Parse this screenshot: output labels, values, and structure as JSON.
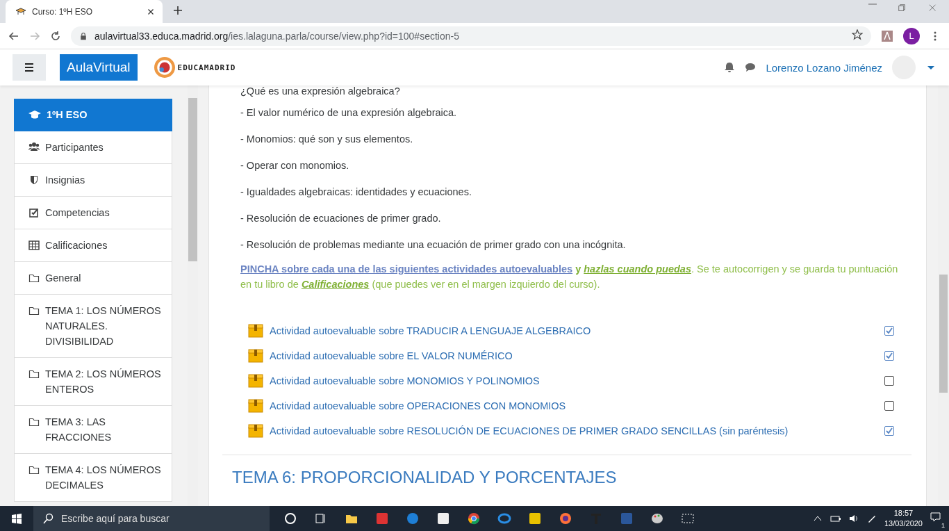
{
  "browser": {
    "tab_title": "Curso: 1ºH ESO",
    "url_host": "aulavirtual33.educa.madrid.org",
    "url_path": "/ies.lalaguna.parla/course/view.php?id=100#section-5",
    "profile_initial": "L"
  },
  "header": {
    "brand": "AulaVirtual",
    "logo_text": "EDUCAMADRID",
    "user_name": "Lorenzo Lozano Jiménez"
  },
  "sidebar": {
    "items": [
      {
        "label": "1ºH ESO",
        "kind": "course",
        "selected": true
      },
      {
        "label": "Participantes",
        "kind": "users",
        "selected": false
      },
      {
        "label": "Insignias",
        "kind": "badge",
        "selected": false
      },
      {
        "label": "Competencias",
        "kind": "check",
        "selected": false
      },
      {
        "label": "Calificaciones",
        "kind": "table",
        "selected": false
      },
      {
        "label": "General",
        "kind": "folder",
        "selected": false
      },
      {
        "label": "TEMA 1: LOS NÚMEROS NATURALES. DIVISIBILIDAD",
        "kind": "folder",
        "selected": false
      },
      {
        "label": "TEMA 2: LOS NÚMEROS ENTEROS",
        "kind": "folder",
        "selected": false
      },
      {
        "label": "TEMA 3: LAS FRACCIONES",
        "kind": "folder",
        "selected": false
      },
      {
        "label": "TEMA 4: LOS NÚMEROS DECIMALES",
        "kind": "folder",
        "selected": false
      }
    ]
  },
  "content": {
    "lines": [
      "¿Qué es una expresión algebraica?",
      "- El valor numérico de una expresión algebraica.",
      "- Monomios: qué son y sus elementos.",
      "- Operar con monomios.",
      "- Igualdades algebraicas: identidades y ecuaciones.",
      "- Resolución de ecuaciones de primer grado.",
      "- Resolución de problemas mediante una ecuación de primer grado con una incógnita."
    ],
    "instruction": [
      {
        "text": "PINCHA sobre cada una de las siguientes actividades autoevaluables",
        "kind": "link"
      },
      {
        "text": " y ",
        "kind": "bold"
      },
      {
        "text": "hazlas cuando puedas",
        "kind": "bold-italic"
      },
      {
        "text": ". Se te autocorrigen y se guarda tu puntuación en tu libro de ",
        "kind": "plain"
      },
      {
        "text": "Calificaciones",
        "kind": "bold-italic"
      },
      {
        "text": " (que puedes ver en el margen izquierdo del curso).",
        "kind": "plain"
      }
    ],
    "activities": [
      {
        "title": "Actividad autoevaluable sobre TRADUCIR A LENGUAJE ALGEBRAICO",
        "checked": true
      },
      {
        "title": "Actividad autoevaluable sobre EL VALOR NUMÉRICO",
        "checked": true
      },
      {
        "title": "Actividad autoevaluable sobre MONOMIOS Y POLINOMIOS",
        "checked": false
      },
      {
        "title": "Actividad autoevaluable sobre OPERACIONES CON MONOMIOS",
        "checked": false
      },
      {
        "title": "Actividad autoevaluable sobre RESOLUCIÓN DE ECUACIONES DE PRIMER GRADO SENCILLAS (sin paréntesis)",
        "checked": true
      }
    ],
    "section_title": "TEMA 6: PROPORCIONALIDAD Y PORCENTAJES"
  },
  "taskbar": {
    "search_placeholder": "Escribe aquí para buscar",
    "time": "18:57",
    "date": "13/03/2020",
    "notifications": "1"
  }
}
